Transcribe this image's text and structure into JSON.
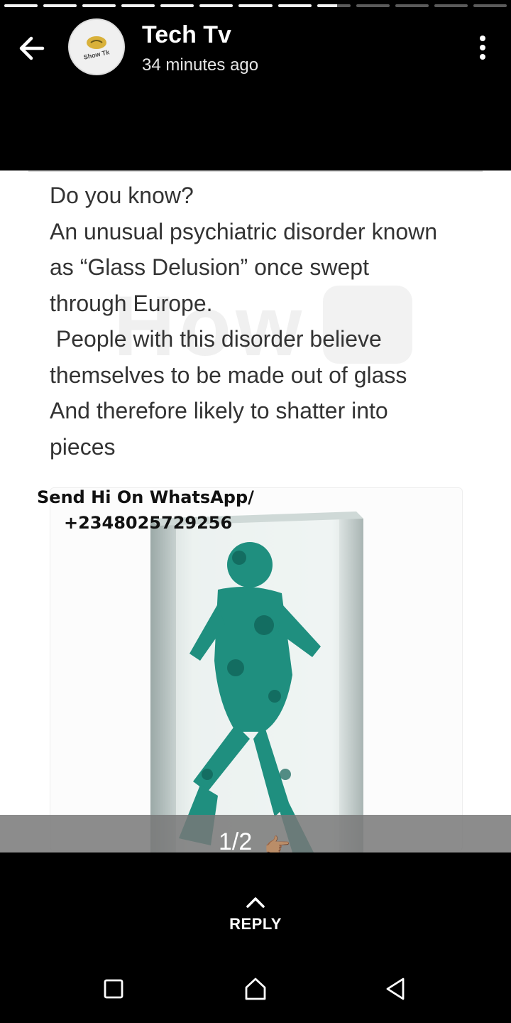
{
  "story": {
    "author": "Tech Tv",
    "time": "34 minutes ago",
    "avatar_text": "Show Tk",
    "segments": {
      "total": 13,
      "complete": 8,
      "current_progress": 0.6
    },
    "body_text": "Do you know?\nAn unusual psychiatric disorder known\nas “Glass Delusion” once swept\nthrough Europe.\n People with this disorder believe\nthemselves to be made out of glass\nAnd therefore likely to shatter into\npieces",
    "watermark": "How",
    "promo_line1": "Send Hi On WhatsApp/",
    "promo_line2": "+2348025729256",
    "counter": "1/2",
    "counter_emoji": "👉🏽"
  },
  "reply": {
    "label": "REPLY"
  },
  "icons": {
    "back": "back-arrow-icon",
    "menu": "more-vert-icon",
    "reply": "chevron-up-icon",
    "nav_recent": "recent-apps-icon",
    "nav_home": "home-icon",
    "nav_back": "nav-back-icon"
  },
  "colors": {
    "background": "#000000",
    "text": "#ffffff",
    "story_text": "#333333"
  }
}
